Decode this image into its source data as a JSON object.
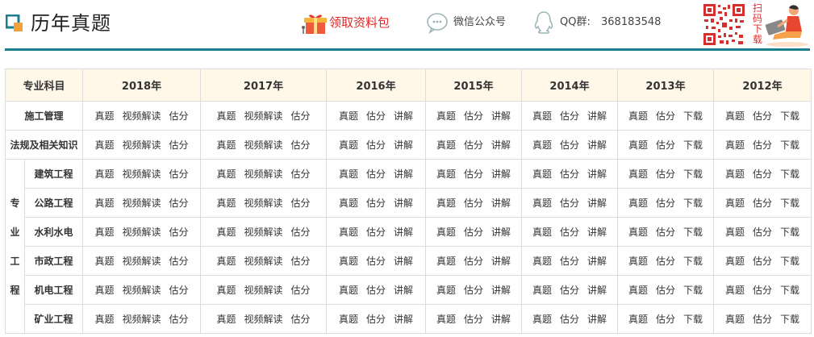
{
  "header": {
    "title": "历年真题",
    "gift_label": "领取资料包",
    "wechat_label": "微信公众号",
    "qq_label": "QQ群:",
    "qq_number": "368183548",
    "scan_chars": [
      "扫",
      "码",
      "下",
      "载"
    ]
  },
  "table": {
    "subject_header": "专业科目",
    "years": [
      "2018年",
      "2017年",
      "2016年",
      "2015年",
      "2014年",
      "2013年",
      "2012年"
    ],
    "group_label_lines": [
      "专业",
      "工程"
    ],
    "rows": [
      {
        "subject": "施工管理",
        "grouped": false,
        "cells": [
          [
            "真题",
            "视频解读",
            "估分"
          ],
          [
            "真题",
            "视频解读",
            "估分"
          ],
          [
            "真题",
            "估分",
            "讲解"
          ],
          [
            "真题",
            "估分",
            "讲解"
          ],
          [
            "真题",
            "估分",
            "讲解"
          ],
          [
            "真题",
            "估分",
            "下载"
          ],
          [
            "真题",
            "估分",
            "下载"
          ]
        ]
      },
      {
        "subject": "法规及相关知识",
        "grouped": false,
        "cells": [
          [
            "真题",
            "视频解读",
            "估分"
          ],
          [
            "真题",
            "视频解读",
            "估分"
          ],
          [
            "真题",
            "估分",
            "讲解"
          ],
          [
            "真题",
            "估分",
            "讲解"
          ],
          [
            "真题",
            "估分",
            "讲解"
          ],
          [
            "真题",
            "估分",
            "下载"
          ],
          [
            "真题",
            "估分",
            "下载"
          ]
        ]
      },
      {
        "subject": "建筑工程",
        "grouped": true,
        "cells": [
          [
            "真题",
            "视频解读",
            "估分"
          ],
          [
            "真题",
            "视频解读",
            "估分"
          ],
          [
            "真题",
            "估分",
            "讲解"
          ],
          [
            "真题",
            "估分",
            "讲解"
          ],
          [
            "真题",
            "估分",
            "讲解"
          ],
          [
            "真题",
            "估分",
            "下载"
          ],
          [
            "真题",
            "估分",
            "下载"
          ]
        ]
      },
      {
        "subject": "公路工程",
        "grouped": true,
        "cells": [
          [
            "真题",
            "视频解读",
            "估分"
          ],
          [
            "真题",
            "视频解读",
            "估分"
          ],
          [
            "真题",
            "估分",
            "讲解"
          ],
          [
            "真题",
            "估分",
            "讲解"
          ],
          [
            "真题",
            "估分",
            "讲解"
          ],
          [
            "真题",
            "估分",
            "下载"
          ],
          [
            "真题",
            "估分",
            "下载"
          ]
        ]
      },
      {
        "subject": "水利水电",
        "grouped": true,
        "cells": [
          [
            "真题",
            "视频解读",
            "估分"
          ],
          [
            "真题",
            "视频解读",
            "估分"
          ],
          [
            "真题",
            "估分",
            "讲解"
          ],
          [
            "真题",
            "估分",
            "讲解"
          ],
          [
            "真题",
            "估分",
            "讲解"
          ],
          [
            "真题",
            "估分",
            "下载"
          ],
          [
            "真题",
            "估分",
            "下载"
          ]
        ]
      },
      {
        "subject": "市政工程",
        "grouped": true,
        "cells": [
          [
            "真题",
            "视频解读",
            "估分"
          ],
          [
            "真题",
            "视频解读",
            "估分"
          ],
          [
            "真题",
            "估分",
            "讲解"
          ],
          [
            "真题",
            "估分",
            "讲解"
          ],
          [
            "真题",
            "估分",
            "讲解"
          ],
          [
            "真题",
            "估分",
            "下载"
          ],
          [
            "真题",
            "估分",
            "下载"
          ]
        ]
      },
      {
        "subject": "机电工程",
        "grouped": true,
        "cells": [
          [
            "真题",
            "视频解读",
            "估分"
          ],
          [
            "真题",
            "视频解读",
            "估分"
          ],
          [
            "真题",
            "估分",
            "讲解"
          ],
          [
            "真题",
            "估分",
            "讲解"
          ],
          [
            "真题",
            "估分",
            "讲解"
          ],
          [
            "真题",
            "估分",
            "下载"
          ],
          [
            "真题",
            "估分",
            "下载"
          ]
        ]
      },
      {
        "subject": "矿业工程",
        "grouped": true,
        "cells": [
          [
            "真题",
            "视频解读",
            "估分"
          ],
          [
            "真题",
            "视频解读",
            "估分"
          ],
          [
            "真题",
            "估分",
            "讲解"
          ],
          [
            "真题",
            "估分",
            "讲解"
          ],
          [
            "真题",
            "估分",
            "讲解"
          ],
          [
            "真题",
            "估分",
            "下载"
          ],
          [
            "真题",
            "估分",
            "下载"
          ]
        ]
      }
    ]
  },
  "colors": {
    "accent": "#1e7d8e",
    "header_bg": "#fff8e9",
    "gift_red": "#e02828",
    "border": "#dcdcdc"
  },
  "icons": [
    "logo-mark-icon",
    "gift-icon",
    "wechat-icon",
    "qq-icon",
    "qr-code-icon",
    "person-illustration-icon"
  ]
}
